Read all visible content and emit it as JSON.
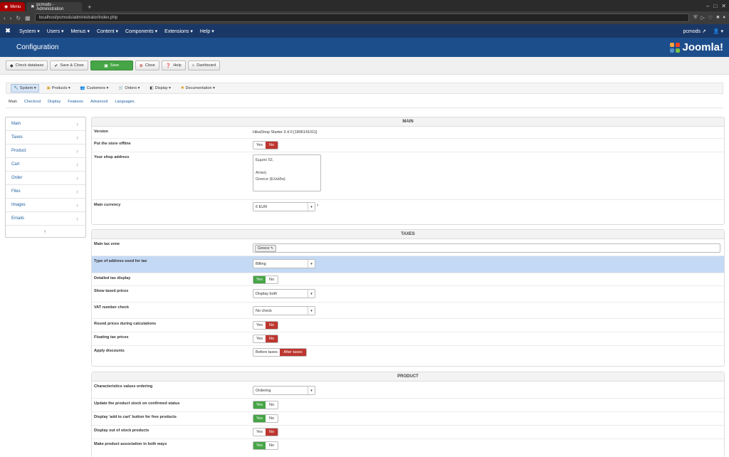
{
  "browser": {
    "menu_label": "Menu",
    "tab_title": "pcmods - Administration",
    "new_tab": "+",
    "url": "localhost/pcmods/administrator/index.php"
  },
  "jnav": {
    "items": [
      "System ▾",
      "Users ▾",
      "Menus ▾",
      "Content ▾",
      "Components ▾",
      "Extensions ▾",
      "Help ▾"
    ],
    "site": "pcmods ↗",
    "user": "👤 ▾"
  },
  "header": {
    "title": "Configuration",
    "brand": "Joomla!"
  },
  "toolbar": {
    "check_database": "Check database",
    "save_close": "Save & Close",
    "save": "Save",
    "close": "Close",
    "help": "Help",
    "dashboard": "Dashboard"
  },
  "hika_menu": [
    "System ▾",
    "Products ▾",
    "Customers ▾",
    "Orders ▾",
    "Display ▾",
    "Documentation ▾"
  ],
  "subtabs": [
    "Main",
    "Checkout",
    "Display",
    "Features",
    "Advanced",
    "Languages"
  ],
  "sidemenu": [
    "Main",
    "Taxes",
    "Product",
    "Cart",
    "Order",
    "Files",
    "Images",
    "Emails"
  ],
  "sidemenu_foot": "⇡",
  "main": {
    "heading": "MAIN",
    "version_label": "Version",
    "version_value": "HikaShop Starter 3.4.0 [1806141011]",
    "offline_label": "Put the store offline",
    "address_label": "Your shop address",
    "address_line1": "Εμμού 52,",
    "address_line2": "",
    "address_line3": "Αττική",
    "address_line4": "Greece (Ελλάδα)",
    "currency_label": "Main currency",
    "currency_value": "€ EUR"
  },
  "taxes": {
    "heading": "TAXES",
    "zone_label": "Main tax zone",
    "zone_value": "Greece ✎",
    "address_type_label": "Type of address used for tax",
    "address_type_value": "Billing",
    "detailed_label": "Detailed tax display",
    "taxed_prices_label": "Show taxed prices",
    "taxed_prices_value": "Display both",
    "vat_label": "VAT number check",
    "vat_value": "No check",
    "round_label": "Round prices during calculations",
    "floating_label": "Floating tax prices",
    "discounts_label": "Apply discounts",
    "before_taxes": "Before taxes",
    "after_taxes": "After taxes"
  },
  "product": {
    "heading": "PRODUCT",
    "ordering_label": "Characteristics values ordering",
    "ordering_value": "Ordering",
    "stock_label": "Update the product stock on confirmed status",
    "free_cart_label": "Display 'add to cart' button for free products",
    "out_of_stock_label": "Display out of stock products",
    "association_label": "Make product association in both ways"
  },
  "yes": "Yes",
  "no": "No"
}
